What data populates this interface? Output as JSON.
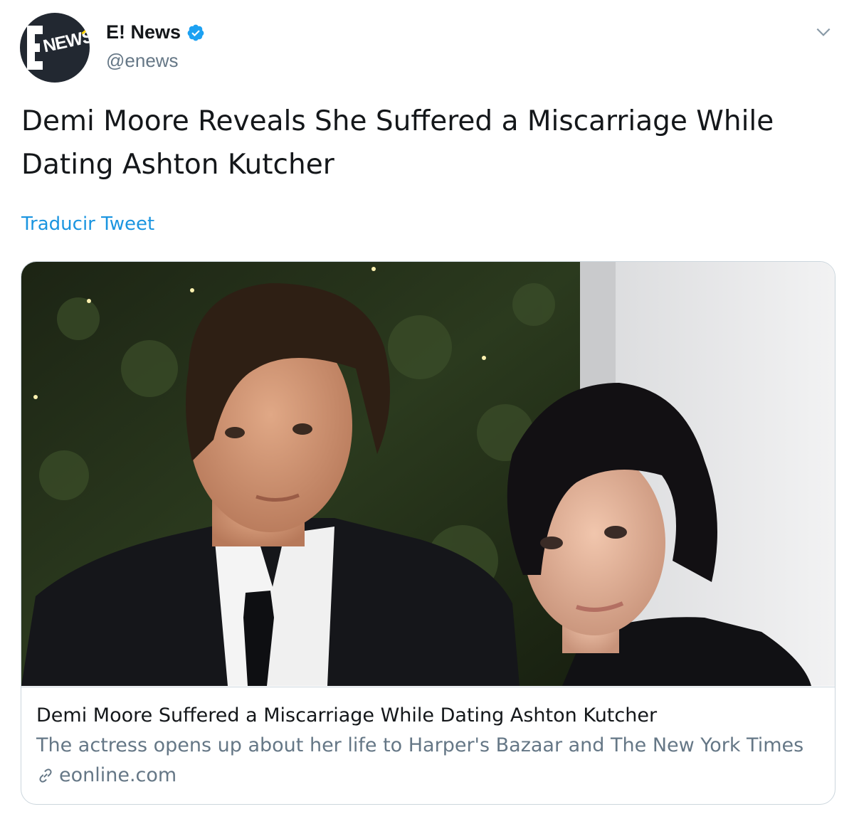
{
  "author": {
    "avatar_text": "NEWS",
    "display_name": "E! News",
    "handle": "@enews",
    "verified": true
  },
  "tweet": {
    "text": "Demi Moore Reveals She Suffered a Miscarriage While Dating Ashton Kutcher",
    "translate_label": "Traducir Tweet"
  },
  "card": {
    "title": "Demi Moore Suffered a Miscarriage While Dating Ashton Kutcher",
    "description": "The actress opens up about her life to Harper's Bazaar and The New York Times",
    "domain": "eonline.com"
  },
  "icons": {
    "verified": "verified-badge-icon",
    "menu": "chevron-down-icon",
    "link": "link-icon"
  },
  "colors": {
    "link_blue": "#1b95e0",
    "secondary_text": "#657786",
    "primary_text": "#14171a",
    "border": "#ccd6dd"
  }
}
